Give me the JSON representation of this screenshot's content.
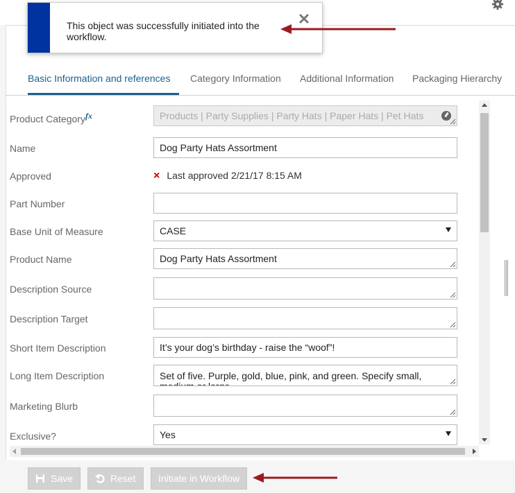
{
  "toast": {
    "message": "This object was successfully initiated into the workflow.",
    "close_icon": "close-icon",
    "stripe_color": "#0033a0"
  },
  "header": {
    "settings_icon": "gear-icon"
  },
  "tabs": [
    {
      "label": "Basic Information and references",
      "active": true
    },
    {
      "label": "Category Information",
      "active": false
    },
    {
      "label": "Additional Information",
      "active": false
    },
    {
      "label": "Packaging Hierarchy",
      "active": false
    }
  ],
  "form": {
    "product_category": {
      "label": "Product Category",
      "fx": "fx",
      "value": "Products | Party Supplies | Party Hats | Paper Hats | Pet Hats"
    },
    "name": {
      "label": "Name",
      "value": "Dog Party Hats Assortment"
    },
    "approved": {
      "label": "Approved",
      "status_icon": "×",
      "value": "Last approved 2/21/17 8:15 AM"
    },
    "part_number": {
      "label": "Part Number",
      "value": ""
    },
    "base_uom": {
      "label": "Base Unit of Measure",
      "value": "CASE"
    },
    "product_name": {
      "label": "Product Name",
      "value": "Dog Party Hats Assortment"
    },
    "description_source": {
      "label": "Description Source",
      "value": ""
    },
    "description_target": {
      "label": "Description Target",
      "value": ""
    },
    "short_item_description": {
      "label": "Short Item Description",
      "value": "It’s your dog’s birthday - raise the “woof”!"
    },
    "long_item_description": {
      "label": "Long Item Description",
      "value": "Set of five. Purple, gold, blue, pink, and green. Specify small, medium or large."
    },
    "marketing_blurb": {
      "label": "Marketing Blurb",
      "value": ""
    },
    "exclusive": {
      "label": "Exclusive?",
      "value": "Yes"
    }
  },
  "actions": {
    "save_label": "Save",
    "reset_label": "Reset",
    "initiate_label": "Initiate in Workflow"
  },
  "colors": {
    "accent": "#1a5f8f",
    "annotation_arrow": "#9b1b20",
    "error": "#cc0000"
  }
}
